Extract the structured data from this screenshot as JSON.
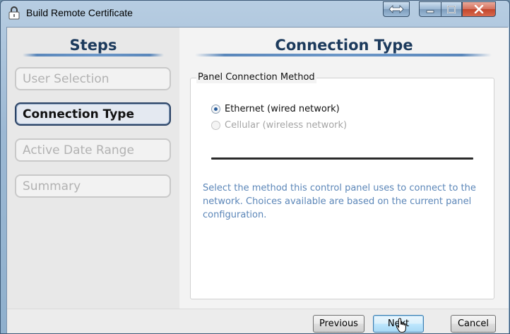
{
  "window": {
    "title": "Build Remote Certificate"
  },
  "steps": {
    "title": "Steps",
    "items": [
      {
        "label": "User Selection",
        "state": "disabled"
      },
      {
        "label": "Connection Type",
        "state": "active"
      },
      {
        "label": "Active Date Range",
        "state": "disabled"
      },
      {
        "label": "Summary",
        "state": "disabled"
      }
    ]
  },
  "main": {
    "title": "Connection Type",
    "group": {
      "legend": "Panel Connection Method",
      "options": [
        {
          "label": "Ethernet (wired network)",
          "checked": true,
          "enabled": true
        },
        {
          "label": "Cellular (wireless network)",
          "checked": false,
          "enabled": false
        }
      ]
    },
    "help_text": "Select the method this control panel uses to connect to the network.  Choices available are based on the current panel configuration."
  },
  "footer": {
    "previous_label": "Previous",
    "next_label": "Next",
    "cancel_label": "Cancel"
  },
  "colors": {
    "title_blue": "#1c3a5c",
    "help_text_blue": "#5b86b8",
    "close_red": "#c2462c"
  },
  "icons": {
    "app": "lock-icon",
    "restore": "double-arrow-icon",
    "minimize": "minimize-icon",
    "maximize": "maximize-icon",
    "close": "close-icon",
    "cursor": "pointer-cursor-icon"
  }
}
